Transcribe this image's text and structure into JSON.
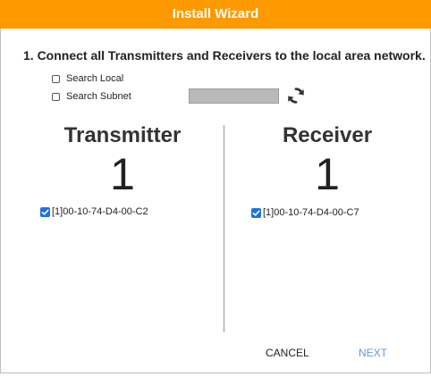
{
  "dialog": {
    "title": "Install Wizard",
    "accent_color": "#ff9900",
    "step_text": "1. Connect all Transmitters and Receivers to the local area network.",
    "search_local": {
      "label": "Search Local",
      "checked": false
    },
    "search_subnet": {
      "label": "Search Subnet",
      "checked": false
    },
    "subnet_input": {
      "value": "",
      "placeholder": ""
    },
    "refresh_icon": "refresh-icon"
  },
  "transmitter": {
    "title": "Transmitter",
    "count": "1",
    "devices": [
      {
        "label": "[1]00-10-74-D4-00-C2",
        "checked": true
      }
    ]
  },
  "receiver": {
    "title": "Receiver",
    "count": "1",
    "devices": [
      {
        "label": "[1]00-10-74-D4-00-C7",
        "checked": true
      }
    ]
  },
  "footer": {
    "cancel_label": "CANCEL",
    "next_label": "NEXT",
    "next_color": "#5b9bd5"
  }
}
